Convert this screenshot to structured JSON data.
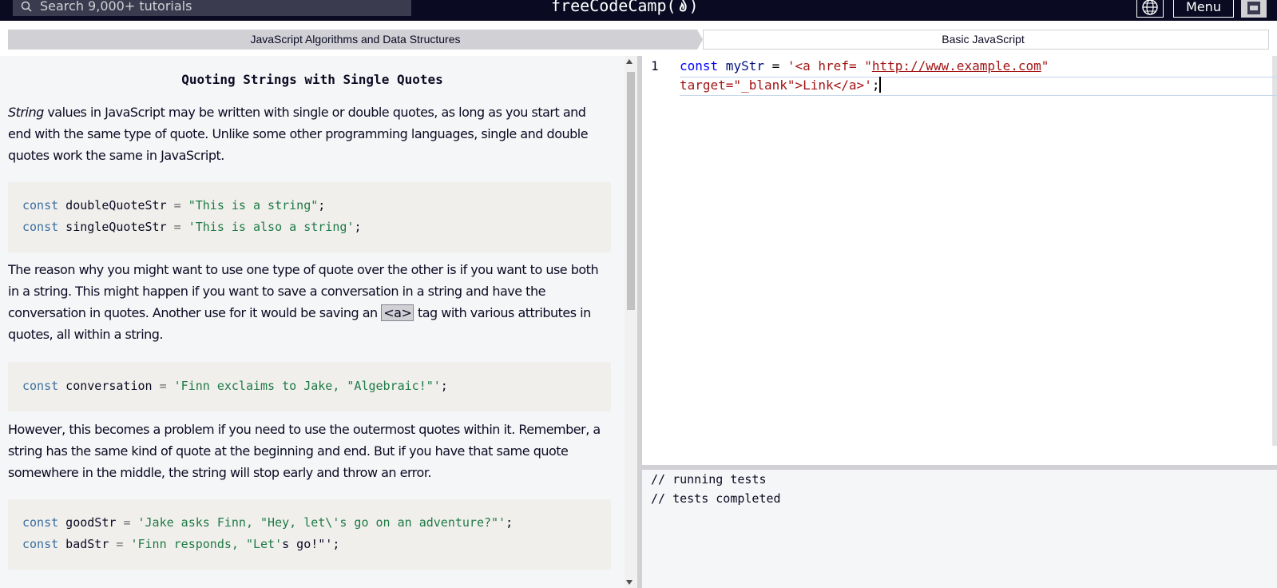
{
  "nav": {
    "search_placeholder": "Search 9,000+ tutorials",
    "logo_text": "freeCodeCamp(",
    "logo_close": ")",
    "menu_label": "Menu"
  },
  "breadcrumb": {
    "superblock": "JavaScript Algorithms and Data Structures",
    "block": "Basic JavaScript"
  },
  "lesson": {
    "title": "Quoting Strings with Single Quotes",
    "p1_em": "String",
    "p1_rest": " values in JavaScript may be written with single or double quotes, as long as you start and end with the same type of quote. Unlike some other programming languages, single and double quotes work the same in JavaScript.",
    "code1": [
      {
        "kw": "const",
        "name": " doubleQuoteStr ",
        "op": "=",
        "str": " \"This is a string\"",
        "end": ";"
      },
      {
        "kw": "const",
        "name": " singleQuoteStr ",
        "op": "=",
        "str": " 'This is also a string'",
        "end": ";"
      }
    ],
    "p2_a": "The reason why you might want to use one type of quote over the other is if you want to use both in a string. This might happen if you want to save a conversation in a string and have the conversation in quotes. Another use for it would be saving an ",
    "p2_code": "<a>",
    "p2_b": " tag with various attributes in quotes, all within a string.",
    "code2": {
      "kw": "const",
      "name": " conversation ",
      "op": "=",
      "str": " 'Finn exclaims to Jake, \"Algebraic!\"'",
      "end": ";"
    },
    "p3": "However, this becomes a problem if you need to use the outermost quotes within it. Remember, a string has the same kind of quote at the beginning and end. But if you have that same quote somewhere in the middle, the string will stop early and throw an error.",
    "code3": [
      {
        "kw": "const",
        "name": " goodStr ",
        "op": "=",
        "str": " 'Jake asks Finn, \"Hey, let\\'s go on an adventure?\"'",
        "end": ";"
      },
      {
        "kw": "const",
        "name": " badStr ",
        "op": "=",
        "str": " 'Finn responds, \"Let'",
        "rest": "s go!\"'",
        "end": ";"
      }
    ]
  },
  "editor": {
    "line_number": "1",
    "kw": "const",
    "var": " myStr ",
    "op": "=",
    "str_open": " '<a href= \"",
    "url": "http://www.example.com",
    "str_close": "\"",
    "line2": "target=\"_blank\">Link</a>'",
    "end": ";"
  },
  "console": {
    "line1": "// running tests",
    "line2": "// tests completed"
  }
}
